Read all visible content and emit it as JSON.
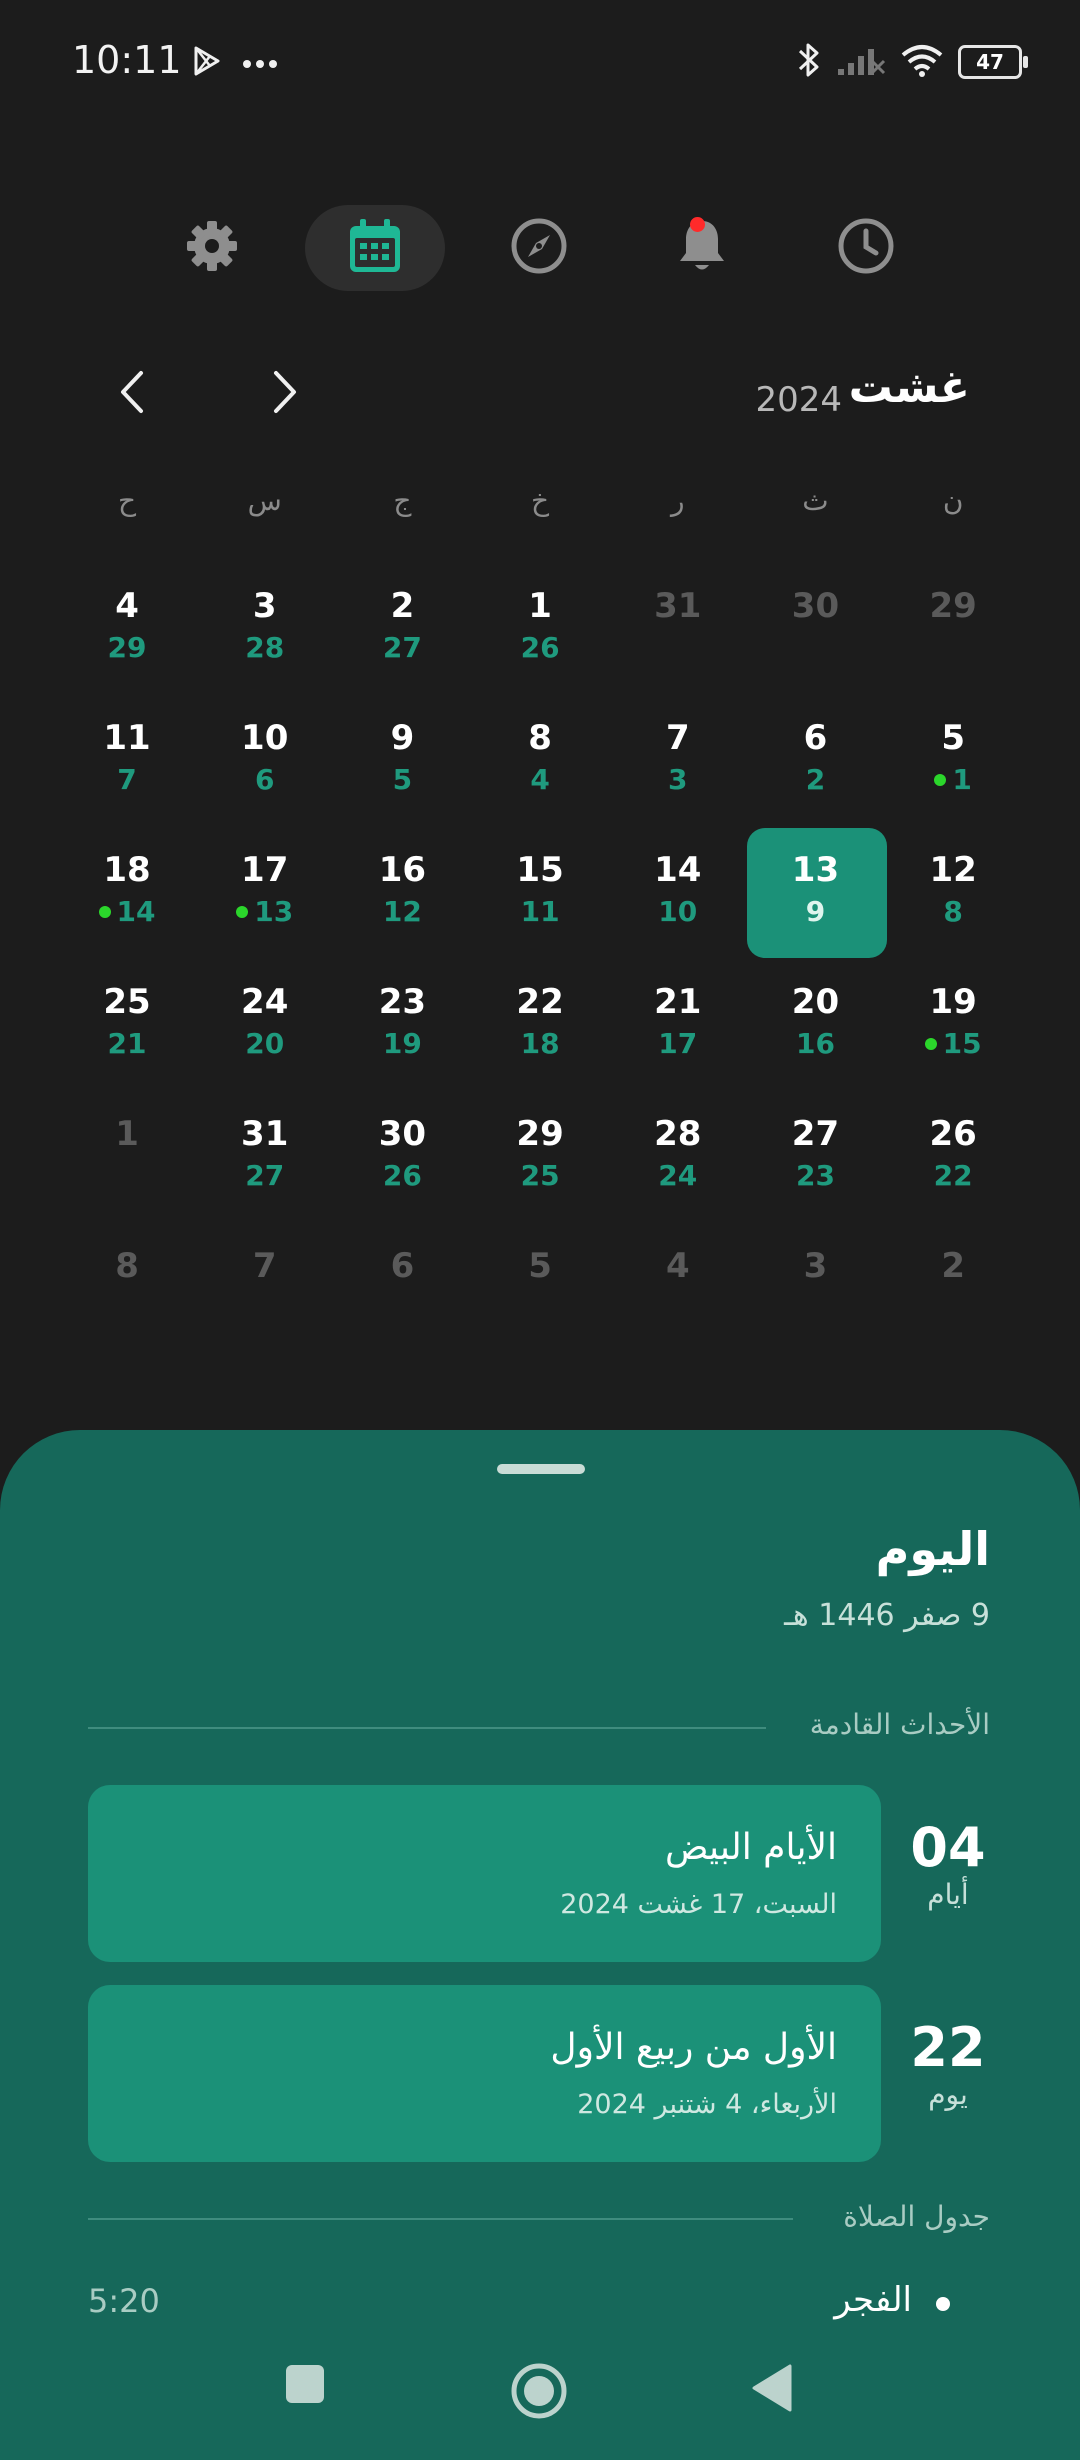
{
  "status_bar": {
    "time": "10:11",
    "battery": "47",
    "icons": [
      "play-store-icon",
      "more-dots-icon",
      "bluetooth-icon",
      "signal-icon",
      "wifi-icon",
      "battery-icon"
    ]
  },
  "top_nav": {
    "items": [
      {
        "name": "settings",
        "icon": "gear-icon",
        "active": false
      },
      {
        "name": "calendar",
        "icon": "calendar-icon",
        "active": true
      },
      {
        "name": "qibla",
        "icon": "compass-icon",
        "active": false
      },
      {
        "name": "notifications",
        "icon": "bell-icon",
        "active": false,
        "has_badge": true
      },
      {
        "name": "prayer-times",
        "icon": "clock-icon",
        "active": false
      }
    ]
  },
  "calendar": {
    "month": "غشت",
    "year": "2024",
    "weekdays": [
      "ن",
      "ث",
      "ر",
      "خ",
      "ج",
      "س",
      "ح"
    ],
    "weeks": [
      [
        {
          "g": "29",
          "h": "",
          "outside": true
        },
        {
          "g": "30",
          "h": "",
          "outside": true
        },
        {
          "g": "31",
          "h": "",
          "outside": true
        },
        {
          "g": "1",
          "h": "26"
        },
        {
          "g": "2",
          "h": "27"
        },
        {
          "g": "3",
          "h": "28"
        },
        {
          "g": "4",
          "h": "29"
        }
      ],
      [
        {
          "g": "5",
          "h": "1",
          "dot": true
        },
        {
          "g": "6",
          "h": "2"
        },
        {
          "g": "7",
          "h": "3"
        },
        {
          "g": "8",
          "h": "4"
        },
        {
          "g": "9",
          "h": "5"
        },
        {
          "g": "10",
          "h": "6"
        },
        {
          "g": "11",
          "h": "7"
        }
      ],
      [
        {
          "g": "12",
          "h": "8"
        },
        {
          "g": "13",
          "h": "9",
          "today": true
        },
        {
          "g": "14",
          "h": "10"
        },
        {
          "g": "15",
          "h": "11"
        },
        {
          "g": "16",
          "h": "12"
        },
        {
          "g": "17",
          "h": "13",
          "dot": true
        },
        {
          "g": "18",
          "h": "14",
          "dot": true
        }
      ],
      [
        {
          "g": "19",
          "h": "15",
          "dot": true
        },
        {
          "g": "20",
          "h": "16"
        },
        {
          "g": "21",
          "h": "17"
        },
        {
          "g": "22",
          "h": "18"
        },
        {
          "g": "23",
          "h": "19"
        },
        {
          "g": "24",
          "h": "20"
        },
        {
          "g": "25",
          "h": "21"
        }
      ],
      [
        {
          "g": "26",
          "h": "22"
        },
        {
          "g": "27",
          "h": "23"
        },
        {
          "g": "28",
          "h": "24"
        },
        {
          "g": "29",
          "h": "25"
        },
        {
          "g": "30",
          "h": "26"
        },
        {
          "g": "31",
          "h": "27"
        },
        {
          "g": "1",
          "h": "",
          "outside": true
        }
      ],
      [
        {
          "g": "2",
          "h": "",
          "outside": true
        },
        {
          "g": "3",
          "h": "",
          "outside": true
        },
        {
          "g": "4",
          "h": "",
          "outside": true
        },
        {
          "g": "5",
          "h": "",
          "outside": true
        },
        {
          "g": "6",
          "h": "",
          "outside": true
        },
        {
          "g": "7",
          "h": "",
          "outside": true
        },
        {
          "g": "8",
          "h": "",
          "outside": true
        }
      ]
    ]
  },
  "sheet": {
    "today_label": "اليوم",
    "hijri_date": "9 صفر 1446 هـ",
    "upcoming_header": "الأحداث القادمة",
    "events": [
      {
        "count": "04",
        "unit": "أيام",
        "title": "الأيام البيض",
        "date": "السبت، 17 غشت 2024"
      },
      {
        "count": "22",
        "unit": "يوم",
        "title": "الأول من ربيع الأول",
        "date": "الأربعاء، 4 شتنبر 2024"
      }
    ],
    "prayer_header": "جدول الصلاة",
    "prayer": {
      "name": "الفجر",
      "time": "5:20"
    }
  },
  "colors": {
    "background": "#1c1c1c",
    "accent": "#1b9178",
    "sheet": "#16685a",
    "hijri_text": "#1f9a7e",
    "event_dot": "#2bd62b",
    "badge": "#ff2a2a"
  }
}
